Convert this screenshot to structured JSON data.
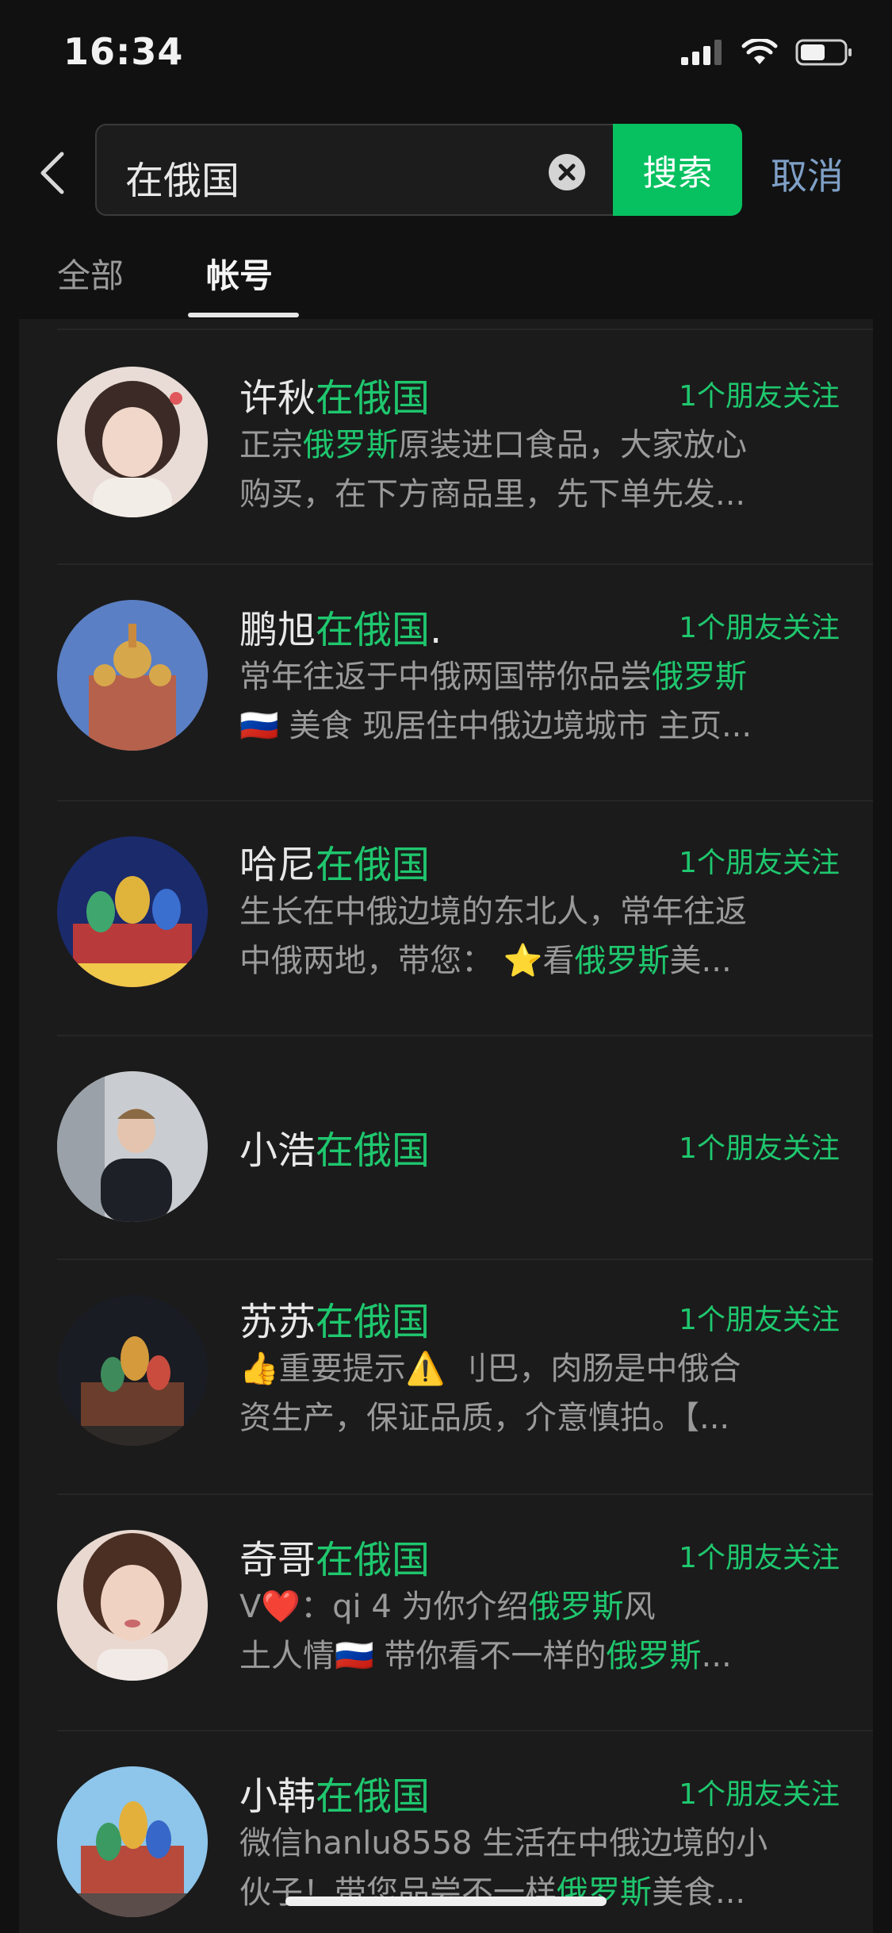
{
  "status_bar": {
    "time": "16:34"
  },
  "search": {
    "query": "在俄国",
    "button": "搜索",
    "cancel": "取消"
  },
  "tabs": [
    {
      "label": "全部"
    },
    {
      "label": "帐号"
    }
  ],
  "results": [
    {
      "name_prefix": "许秋",
      "name_hl": "在俄国",
      "name_suffix": "",
      "friends": "1个朋友关注",
      "line1": [
        {
          "t": "正宗"
        },
        {
          "t": "俄罗斯",
          "h": true
        },
        {
          "t": "原装进口食品，大家放心"
        }
      ],
      "line2": [
        {
          "t": "购买，在下方商品里，先下单先发..."
        }
      ]
    },
    {
      "name_prefix": "鹏旭",
      "name_hl": "在俄国",
      "name_suffix": ".",
      "friends": "1个朋友关注",
      "line1": [
        {
          "t": "常年往返于中俄两国带你品尝"
        },
        {
          "t": "俄罗斯",
          "h": true
        }
      ],
      "line2": [
        {
          "t": "🇷🇺 美食 现居住中俄边境城市 主页..."
        }
      ]
    },
    {
      "name_prefix": "哈尼",
      "name_hl": "在俄国",
      "name_suffix": "",
      "friends": "1个朋友关注",
      "line1": [
        {
          "t": "生长在中俄边境的东北人，常年往返"
        }
      ],
      "line2": [
        {
          "t": "中俄两地，带您： ⭐看"
        },
        {
          "t": "俄罗斯",
          "h": true
        },
        {
          "t": "美..."
        }
      ]
    },
    {
      "name_prefix": "小浩",
      "name_hl": "在俄国",
      "name_suffix": "",
      "friends": "1个朋友关注",
      "line1": [],
      "line2": []
    },
    {
      "name_prefix": "苏苏",
      "name_hl": "在俄国",
      "name_suffix": "",
      "friends": "1个朋友关注",
      "line1": [
        {
          "t": "👍重要提示⚠️  ​刂巴，肉肠是中俄合"
        }
      ],
      "line2": [
        {
          "t": "资生产，保证品质，介意慎拍。【..."
        }
      ]
    },
    {
      "name_prefix": "奇哥",
      "name_hl": "在俄国",
      "name_suffix": "",
      "friends": "1个朋友关注",
      "line1": [
        {
          "t": "V❤️：qi       4 为你介绍"
        },
        {
          "t": "俄罗斯",
          "h": true
        },
        {
          "t": "风"
        }
      ],
      "line2": [
        {
          "t": "土人情🇷🇺 带你看不一样的"
        },
        {
          "t": "俄罗斯",
          "h": true
        },
        {
          "t": "..."
        }
      ]
    },
    {
      "name_prefix": "小韩",
      "name_hl": "在俄国",
      "name_suffix": "",
      "friends": "1个朋友关注",
      "line1": [
        {
          "t": "微信hanlu8558 生活在中俄边境的小"
        }
      ],
      "line2": [
        {
          "t": "伙子！带您品尝不一样"
        },
        {
          "t": "俄罗斯",
          "h": true
        },
        {
          "t": "美食..."
        }
      ]
    }
  ],
  "colors": {
    "accent": "#07c160",
    "highlight": "#1fc76e",
    "background": "#111111",
    "link": "#7fa0c7"
  }
}
